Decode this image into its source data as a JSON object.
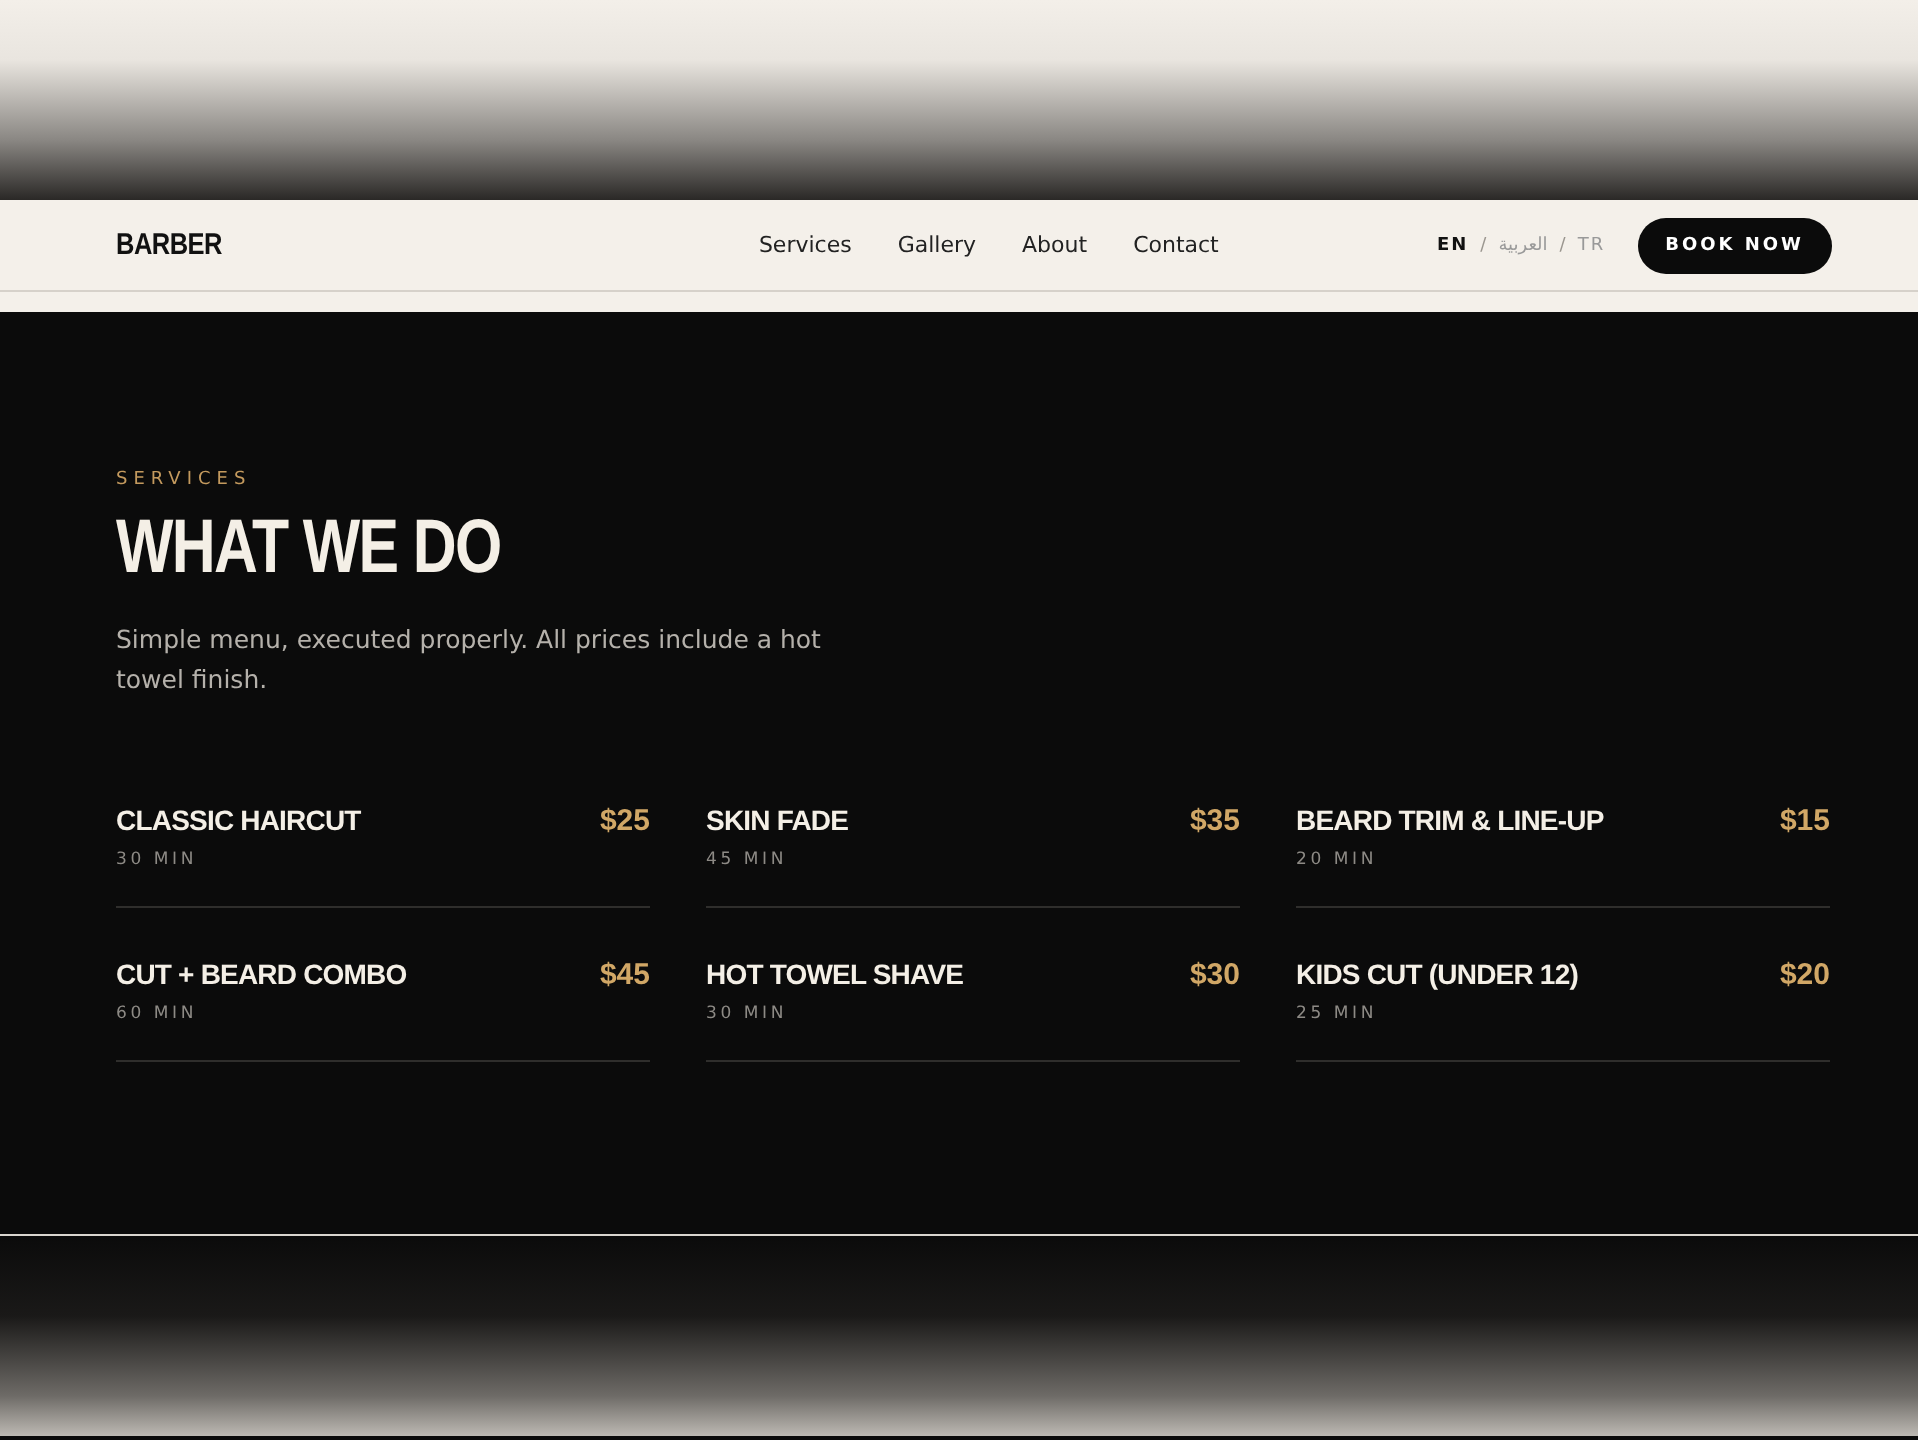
{
  "nav": {
    "logo": "BARBER",
    "links": [
      "Services",
      "Gallery",
      "About",
      "Contact"
    ],
    "languages": [
      {
        "label": "EN",
        "selected": true
      },
      {
        "label": "العربية",
        "selected": false
      },
      {
        "label": "TR",
        "selected": false
      }
    ],
    "language_separator": "/",
    "cta": "BOOK NOW"
  },
  "section": {
    "eyebrow": "SERVICES",
    "title": "WHAT WE DO",
    "lead": "Simple menu, executed properly. All prices include a hot towel finish.",
    "services": [
      {
        "name": "CLASSIC HAIRCUT",
        "price": "$25",
        "duration": "30 MIN"
      },
      {
        "name": "SKIN FADE",
        "price": "$35",
        "duration": "45 MIN"
      },
      {
        "name": "BEARD TRIM & LINE-UP",
        "price": "$15",
        "duration": "20 MIN"
      },
      {
        "name": "CUT + BEARD COMBO",
        "price": "$45",
        "duration": "60 MIN"
      },
      {
        "name": "HOT TOWEL SHAVE",
        "price": "$30",
        "duration": "30 MIN"
      },
      {
        "name": "KIDS CUT (UNDER 12)",
        "price": "$20",
        "duration": "25 MIN"
      }
    ]
  }
}
